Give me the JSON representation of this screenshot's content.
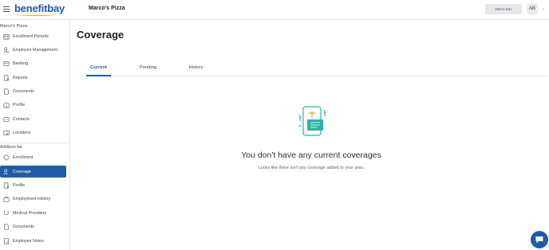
{
  "header": {
    "logo_text": "benefitbay",
    "company_name": "Marco's Pizza",
    "demo_button": "Demo Env",
    "avatar_initials": "AB"
  },
  "sidebar": {
    "company_section": "Marco's Pizza",
    "company_items": [
      {
        "label": "Enrollment Periods",
        "icon": "calendar-grid-icon"
      },
      {
        "label": "Employee Management",
        "icon": "user-gear-icon"
      },
      {
        "label": "Banking",
        "icon": "bank-card-icon"
      },
      {
        "label": "Reports",
        "icon": "report-icon"
      },
      {
        "label": "Documents",
        "icon": "document-icon"
      },
      {
        "label": "Profile",
        "icon": "building-icon"
      },
      {
        "label": "Contacts",
        "icon": "contacts-card-icon"
      },
      {
        "label": "Locations",
        "icon": "location-map-icon"
      }
    ],
    "employee_section": "Addison ba",
    "employee_items": [
      {
        "label": "Enrollment",
        "icon": "shield-heart-icon"
      },
      {
        "label": "Coverage",
        "icon": "coverage-user-icon",
        "active": true
      },
      {
        "label": "Profile",
        "icon": "profile-card-icon"
      },
      {
        "label": "Employment History",
        "icon": "briefcase-history-icon"
      },
      {
        "label": "Medical Providers",
        "icon": "stethoscope-icon"
      },
      {
        "label": "Documents",
        "icon": "document-icon"
      },
      {
        "label": "Employee Notes",
        "icon": "notes-icon"
      }
    ]
  },
  "main": {
    "title": "Coverage",
    "tabs": [
      {
        "label": "Current",
        "active": true
      },
      {
        "label": "Pending"
      },
      {
        "label": "History"
      }
    ],
    "empty_state": {
      "title": "You don't have any current coverages",
      "subtitle": "Looks like there isn't any coverage added to your plan."
    }
  },
  "colors": {
    "brand_blue": "#1f5ba6",
    "logo_accent": "#f2a900",
    "illustration_teal": "#2bb3a7"
  }
}
